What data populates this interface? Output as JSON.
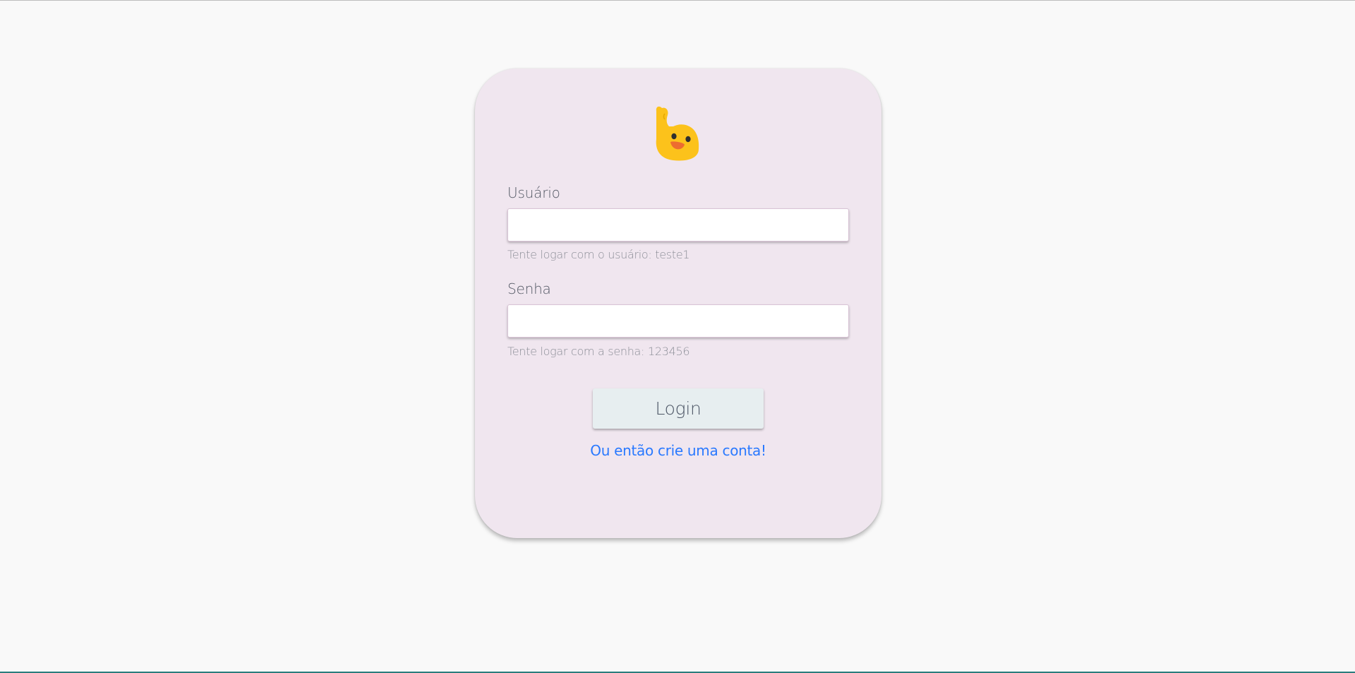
{
  "login_form": {
    "mascot_icon": "waving-hand-blob-icon",
    "username": {
      "label": "Usuário",
      "value": "",
      "placeholder": "",
      "hint": "Tente logar com o usuário: teste1"
    },
    "password": {
      "label": "Senha",
      "value": "",
      "placeholder": "",
      "hint": "Tente logar com a senha: 123456"
    },
    "login_button_label": "Login",
    "create_account_link": "Ou então crie uma conta!"
  },
  "colors": {
    "page_background": "#f9f9f9",
    "card_background": "#f0e6ef",
    "button_background": "#e7eef0",
    "link": "#2979ff",
    "mascot_yellow": "#fcc21b",
    "mascot_mouth": "#ed6c30"
  }
}
